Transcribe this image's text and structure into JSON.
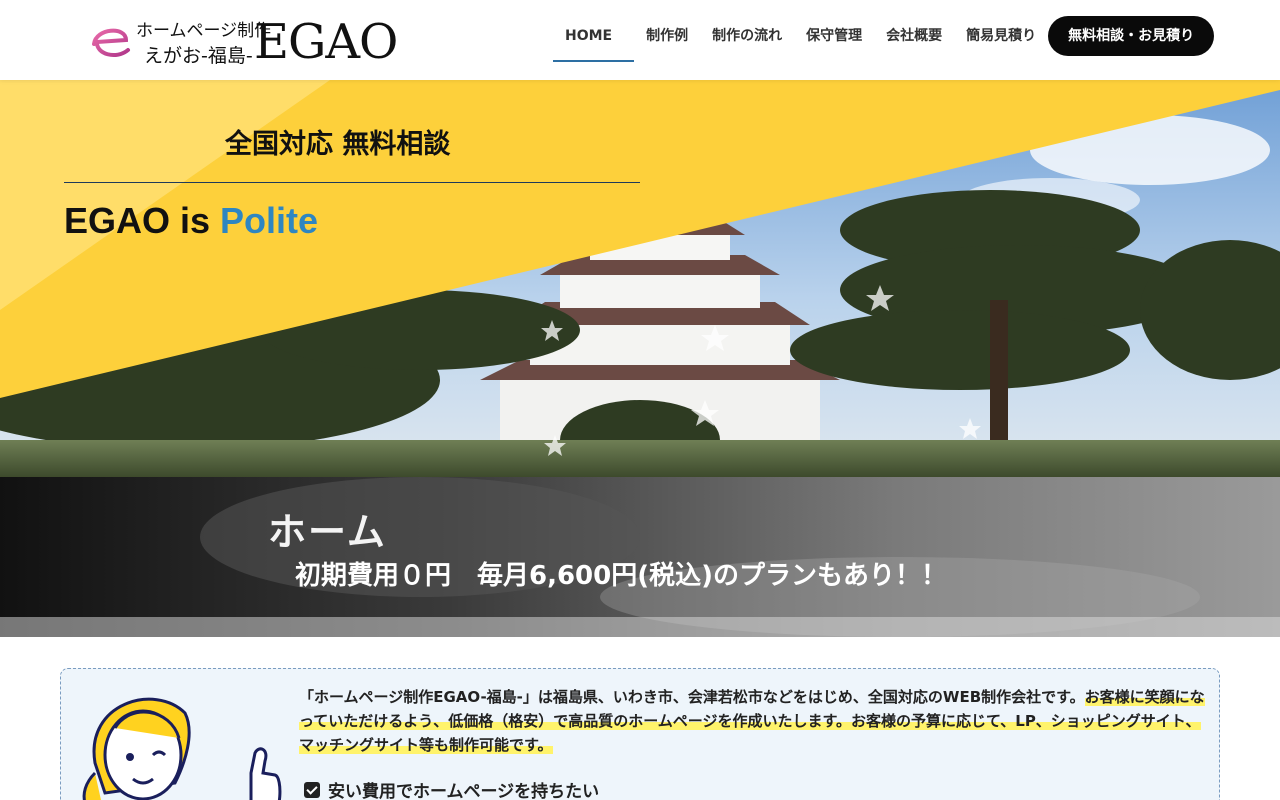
{
  "logo": {
    "line1": "ホームページ制作",
    "line2": "えがお-福島-",
    "wordmark": "EGAO"
  },
  "nav": {
    "items": [
      {
        "label": "HOME",
        "active": true
      },
      {
        "label": "制作例"
      },
      {
        "label": "制作の流れ"
      },
      {
        "label": "保守管理"
      },
      {
        "label": "会社概要"
      },
      {
        "label": "簡易見積り"
      }
    ],
    "cta": "無料相談・お見積り"
  },
  "hero": {
    "title": "全国対応 無料相談",
    "tagline_prefix": "EGAO is ",
    "tagline_accent": "Polite"
  },
  "band": {
    "title": "ホーム",
    "subtitle": "初期費用０円　毎月6,600円(税込)のプランもあり！！"
  },
  "intro": {
    "text_plain": "「ホームページ制作EGAO-福島-」は福島県、いわき市、会津若松市などをはじめ、全国対応のWEB制作会社です。",
    "text_highlight": "お客様に笑顔になっていただけるよう、低価格（格安）で高品質のホームページを作成いたします。お客様の予算に応じて、LP、ショッピングサイト、マッチングサイト等も制作可能です。",
    "checklist": [
      "安い費用でホームページを持ちたい"
    ]
  },
  "colors": {
    "accent_blue": "#2e86c1",
    "hero_yellow": "#fdd03b",
    "highlight_yellow": "#fff36b"
  }
}
